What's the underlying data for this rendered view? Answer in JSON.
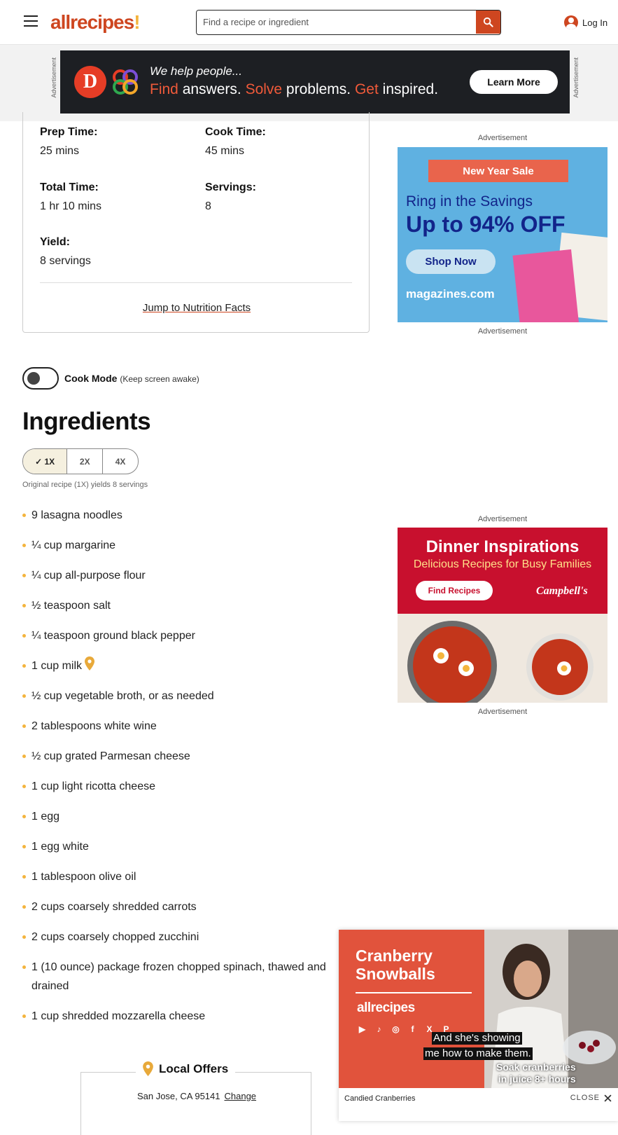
{
  "header": {
    "logo_text": "allrecipes",
    "search_placeholder": "Find a recipe or ingredient",
    "login_label": "Log In"
  },
  "top_ad": {
    "side_label": "Advertisement",
    "tagline_small": "We help people...",
    "tagline_parts": [
      "Find",
      " answers. ",
      "Solve",
      " problems. ",
      "Get",
      " inspired."
    ],
    "cta": "Learn More"
  },
  "details": {
    "prep_label": "Prep Time:",
    "prep_value": "25 mins",
    "cook_label": "Cook Time:",
    "cook_value": "45 mins",
    "total_label": "Total Time:",
    "total_value": "1 hr 10 mins",
    "servings_label": "Servings:",
    "servings_value": "8",
    "yield_label": "Yield:",
    "yield_value": "8 servings",
    "jump_link": "Jump to Nutrition Facts"
  },
  "cook_mode": {
    "label": "Cook Mode",
    "note": "(Keep screen awake)",
    "enabled": false
  },
  "ingredients": {
    "heading": "Ingredients",
    "scale_options": [
      "✓ 1X",
      "2X",
      "4X"
    ],
    "selected_scale": "1X",
    "yield_note": "Original recipe (1X) yields 8 servings",
    "items": [
      "9 lasagna noodles",
      "¼ cup margarine",
      "¼ cup all-purpose flour",
      "½ teaspoon salt",
      "¼ teaspoon ground black pepper",
      "1 cup milk",
      "½ cup vegetable broth, or as needed",
      "2 tablespoons white wine",
      "½ cup grated Parmesan cheese",
      "1 cup light ricotta cheese",
      "1 egg",
      "1 egg white",
      "1 tablespoon olive oil",
      "2 cups coarsely shredded carrots",
      "2 cups coarsely chopped zucchini",
      "1 (10 ounce) package frozen chopped spinach, thawed and drained",
      "1 cup shredded mozzarella cheese"
    ]
  },
  "right_ads": {
    "label": "Advertisement",
    "magazine": {
      "ribbon": "New Year Sale",
      "line1": "Ring in the Savings",
      "line2": "Up to 94% OFF",
      "cta": "Shop Now",
      "brand": "magazines.com"
    },
    "campbells": {
      "title": "Dinner Inspirations",
      "subtitle": "Delicious Recipes for Busy Families",
      "cta": "Find Recipes",
      "brand": "Campbell's"
    }
  },
  "video": {
    "title": "Cranberry Snowballs",
    "brand": "allrecipes",
    "caption_main_1": "And she's showing",
    "caption_main_2": "me how to make them.",
    "caption_side_1": "Soak cranberries",
    "caption_side_2": "in juice 8+ hours",
    "now_playing": "Candied Cranberries",
    "close_label": "CLOSE"
  },
  "local_offers": {
    "title": "Local Offers",
    "location": "San Jose, CA 95141",
    "change_link": "Change"
  }
}
